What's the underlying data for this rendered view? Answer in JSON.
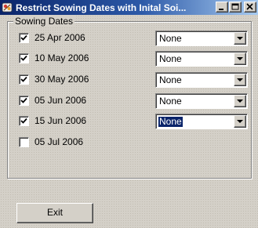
{
  "window": {
    "title": "Restrict Sowing Dates with Inital Soi...",
    "icon": "app-icon",
    "controls": [
      "minimize-icon",
      "maximize-icon",
      "close-icon"
    ]
  },
  "group": {
    "label": "Sowing Dates"
  },
  "rows": [
    {
      "date": "25 Apr 2006",
      "checked": true,
      "value": "None",
      "has_select": true,
      "selected": false
    },
    {
      "date": "10 May 2006",
      "checked": true,
      "value": "None",
      "has_select": true,
      "selected": false
    },
    {
      "date": "30 May 2006",
      "checked": true,
      "value": "None",
      "has_select": true,
      "selected": false
    },
    {
      "date": "05 Jun 2006",
      "checked": true,
      "value": "None",
      "has_select": true,
      "selected": false
    },
    {
      "date": "15 Jun 2006",
      "checked": true,
      "value": "None",
      "has_select": true,
      "selected": true
    },
    {
      "date": "05 Jul 2006",
      "checked": false,
      "value": "",
      "has_select": false,
      "selected": false
    }
  ],
  "buttons": {
    "exit_label": "Exit"
  },
  "colors": {
    "titlebar_start": "#0a246a",
    "titlebar_end": "#a6caf0",
    "face": "#d4d0c8",
    "selection": "#0a246a"
  }
}
